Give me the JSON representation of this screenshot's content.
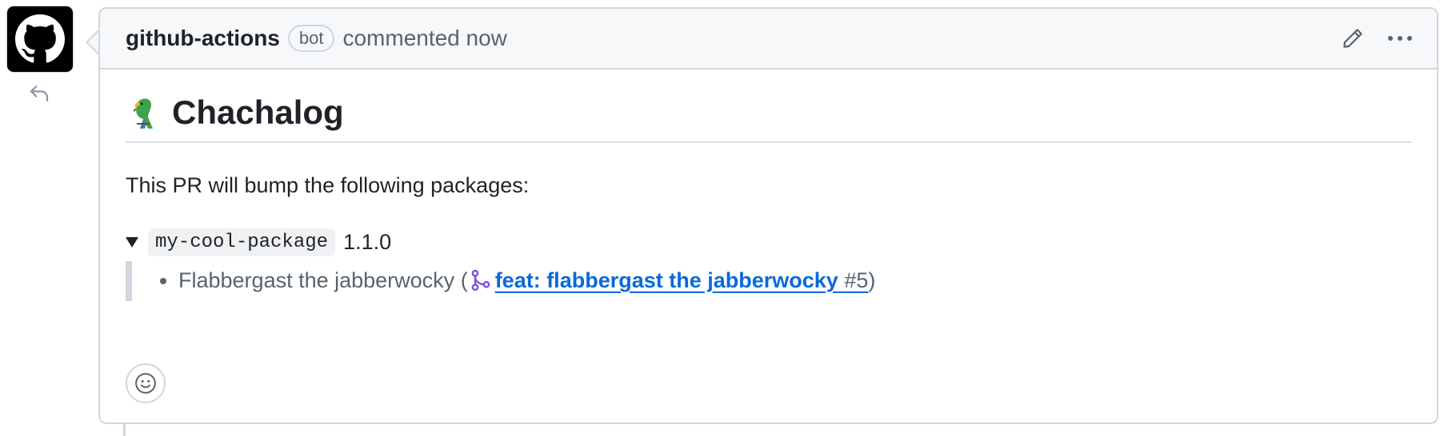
{
  "comment": {
    "author": "github-actions",
    "badge": "bot",
    "meta": "commented now",
    "title": "Chachalog",
    "intro": "This PR will bump the following packages:",
    "package": {
      "name": "my-cool-package",
      "version": "1.1.0",
      "change_text": "Flabbergast the jabberwocky (",
      "pr_title": "feat: flabbergast the jabberwocky",
      "pr_number": "#5",
      "close_paren": ")"
    }
  },
  "colors": {
    "link": "#0969da",
    "pr_icon": "#8250df",
    "muted": "#59636e",
    "border": "#d0d7de"
  },
  "icons": {
    "avatar": "github-mark-icon",
    "reply": "reply-icon",
    "edit": "pencil-icon",
    "more": "kebab-horizontal-icon",
    "title_emoji": "parrot-icon",
    "pr": "git-pull-request-icon",
    "reaction": "smiley-icon"
  }
}
